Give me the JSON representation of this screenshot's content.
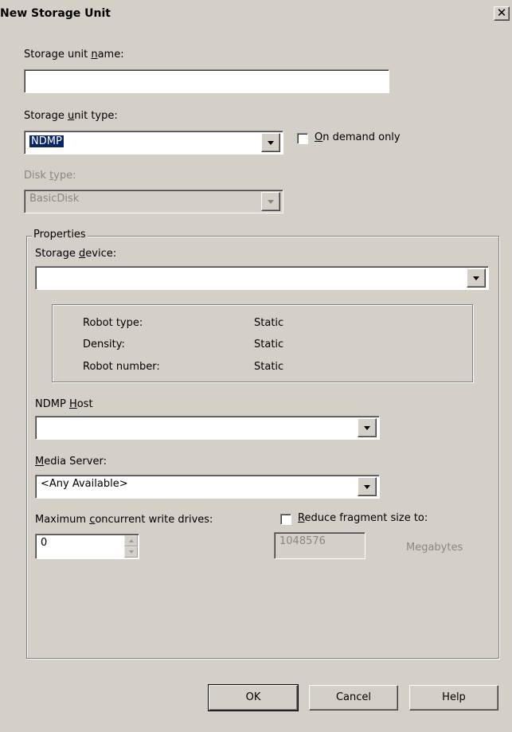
{
  "window": {
    "title": "New Storage Unit",
    "close_label": "✕"
  },
  "storage_unit_name": {
    "label_pre": "Storage unit ",
    "label_ul": "n",
    "label_post": "ame:",
    "value": ""
  },
  "storage_unit_type": {
    "label_pre": "Storage ",
    "label_ul": "u",
    "label_post": "nit type:",
    "value": "NDMP"
  },
  "on_demand": {
    "label_ul": "O",
    "label_post": "n demand only",
    "checked": false
  },
  "disk_type": {
    "label_pre": "Disk ",
    "label_ul": "t",
    "label_post": "ype:",
    "value": "BasicDisk"
  },
  "properties": {
    "caption": "Properties",
    "storage_device": {
      "label_pre": "Storage ",
      "label_ul": "d",
      "label_post": "evice:",
      "value": ""
    },
    "info": [
      {
        "key": "Robot type:",
        "value": "Static"
      },
      {
        "key": "Density:",
        "value": "Static"
      },
      {
        "key": "Robot number:",
        "value": "Static"
      }
    ],
    "ndmp_host": {
      "label_pre": "NDMP ",
      "label_ul": "H",
      "label_post": "ost",
      "value": ""
    },
    "media_server": {
      "label_ul": "M",
      "label_post": "edia Server:",
      "value": "<Any Available>"
    },
    "max_drives": {
      "label_pre": "Maximum ",
      "label_ul": "c",
      "label_post": "oncurrent write drives:",
      "value": "0"
    },
    "reduce_fragment": {
      "label_ul": "R",
      "label_post": "educe fragment size to:",
      "checked": false,
      "value": "1048576",
      "unit": "Megabytes"
    }
  },
  "buttons": {
    "ok": "OK",
    "cancel": "Cancel",
    "help": "Help"
  },
  "colors": {
    "background": "#d4d0c8",
    "selection": "#0a246a",
    "disabled_text": "#8a8780"
  }
}
